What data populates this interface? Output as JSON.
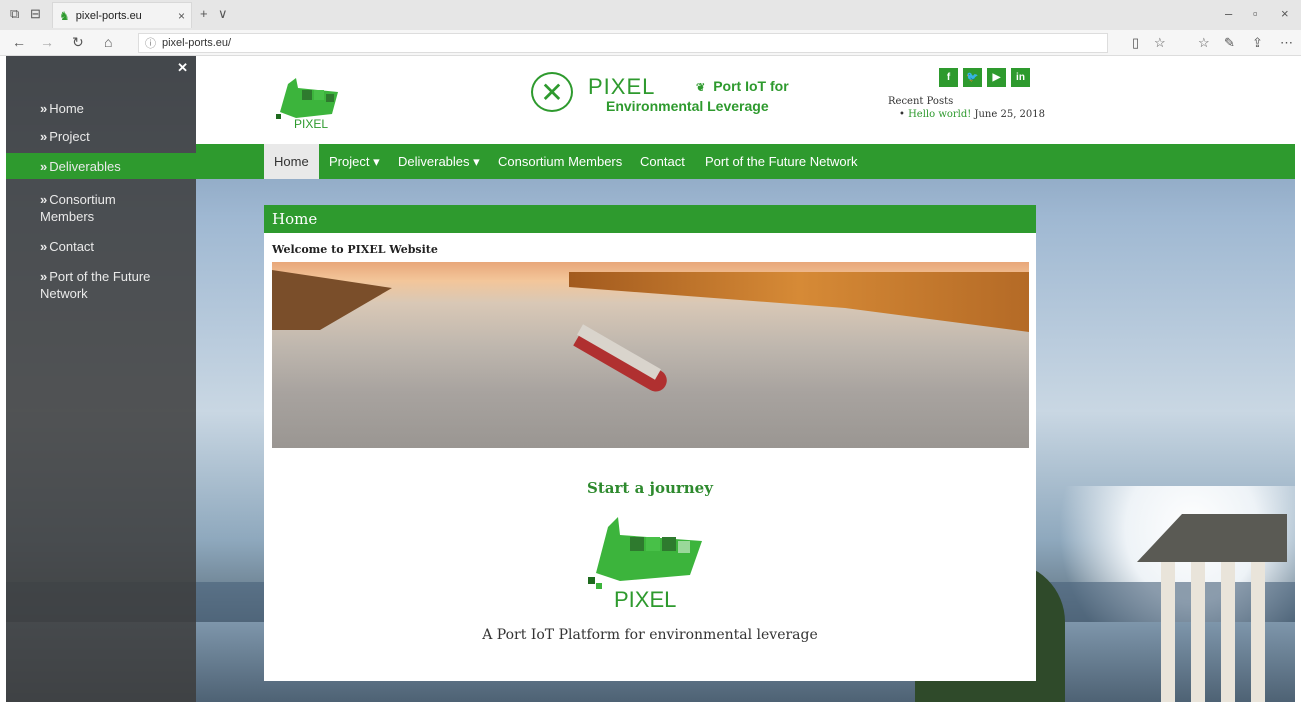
{
  "browser": {
    "tab_title": "pixel-ports.eu",
    "url": "pixel-ports.eu/"
  },
  "sidebar": {
    "items": [
      {
        "label": "Home"
      },
      {
        "label": "Project"
      },
      {
        "label": "Deliverables"
      },
      {
        "label": "Consortium Members"
      },
      {
        "label": "Contact"
      },
      {
        "label": "Port of the Future Network"
      }
    ]
  },
  "header": {
    "logo_text": "PIXEL",
    "brand_name": "PIXEL",
    "tagline_line1": "Port IoT for",
    "tagline_line2": "Environmental Leverage",
    "social": [
      "f",
      "t",
      "yt",
      "in"
    ],
    "recent_posts_title": "Recent Posts",
    "recent_post_link": "Hello world!",
    "recent_post_date": "June 25, 2018"
  },
  "nav": {
    "items": [
      {
        "label": "Home"
      },
      {
        "label": "Project ▾"
      },
      {
        "label": "Deliverables ▾"
      },
      {
        "label": "Consortium Members"
      },
      {
        "label": "Contact"
      },
      {
        "label": "Port of the Future Network"
      }
    ]
  },
  "content": {
    "heading": "Home",
    "welcome": "Welcome to PIXEL Website",
    "journey": "Start a journey",
    "logo_text": "PIXEL",
    "tagline": "A Port IoT Platform for environmental leverage"
  },
  "colors": {
    "accent": "#2e9a2e"
  }
}
